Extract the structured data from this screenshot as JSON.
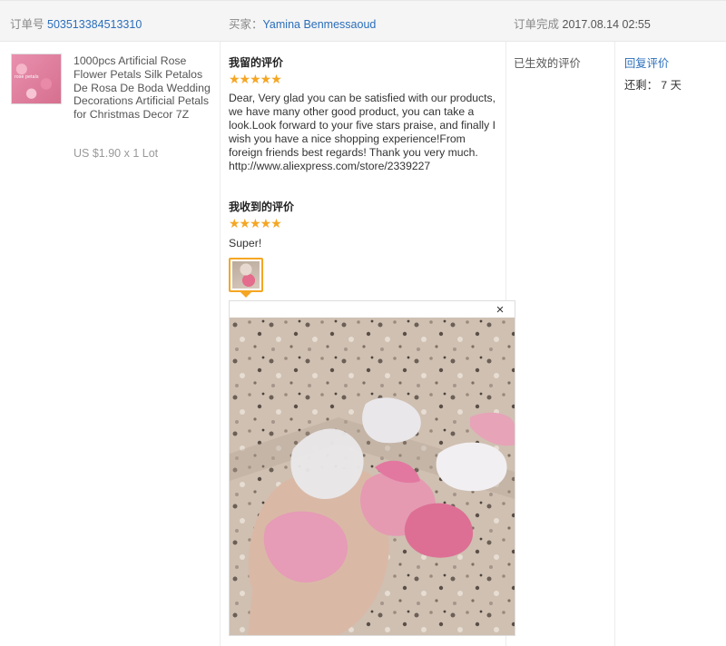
{
  "header": {
    "order_label": "订单号",
    "order_number": "503513384513310",
    "buyer_label": "买家：",
    "buyer_name": "Yamina Benmessaoud",
    "complete_label": "订单完成",
    "complete_time": "2017.08.14 02:55"
  },
  "product": {
    "thumbnail_text": "rose petals",
    "title": "1000pcs Artificial Rose Flower Petals Silk Petalos De Rosa De Boda Wedding Decorations Artificial Petals for Christmas Decor 7Z",
    "price": "US $1.90 x 1 Lot"
  },
  "my_review": {
    "label": "我留的评价",
    "stars": "★★★★★",
    "text": "Dear, Very glad you can be satisfied with our products, we have many other good product, you can take a look.Look forward to your five stars praise, and finally I wish you have a nice shopping experience!From foreign friends best regards! Thank you very much. http://www.aliexpress.com/store/2339227"
  },
  "received_review": {
    "label": "我收到的评价",
    "stars": "★★★★★",
    "text": "Super!"
  },
  "viewer": {
    "close": "×"
  },
  "status": {
    "text": "已生效的评价"
  },
  "actions": {
    "reply_label": "回复评价",
    "remaining": "还剩： 7 天"
  },
  "colors": {
    "link": "#2a6ebb",
    "star": "#f5a623",
    "header_bg": "#f5f5f5"
  },
  "icons": {
    "close": "close-icon",
    "star": "star-icon"
  }
}
